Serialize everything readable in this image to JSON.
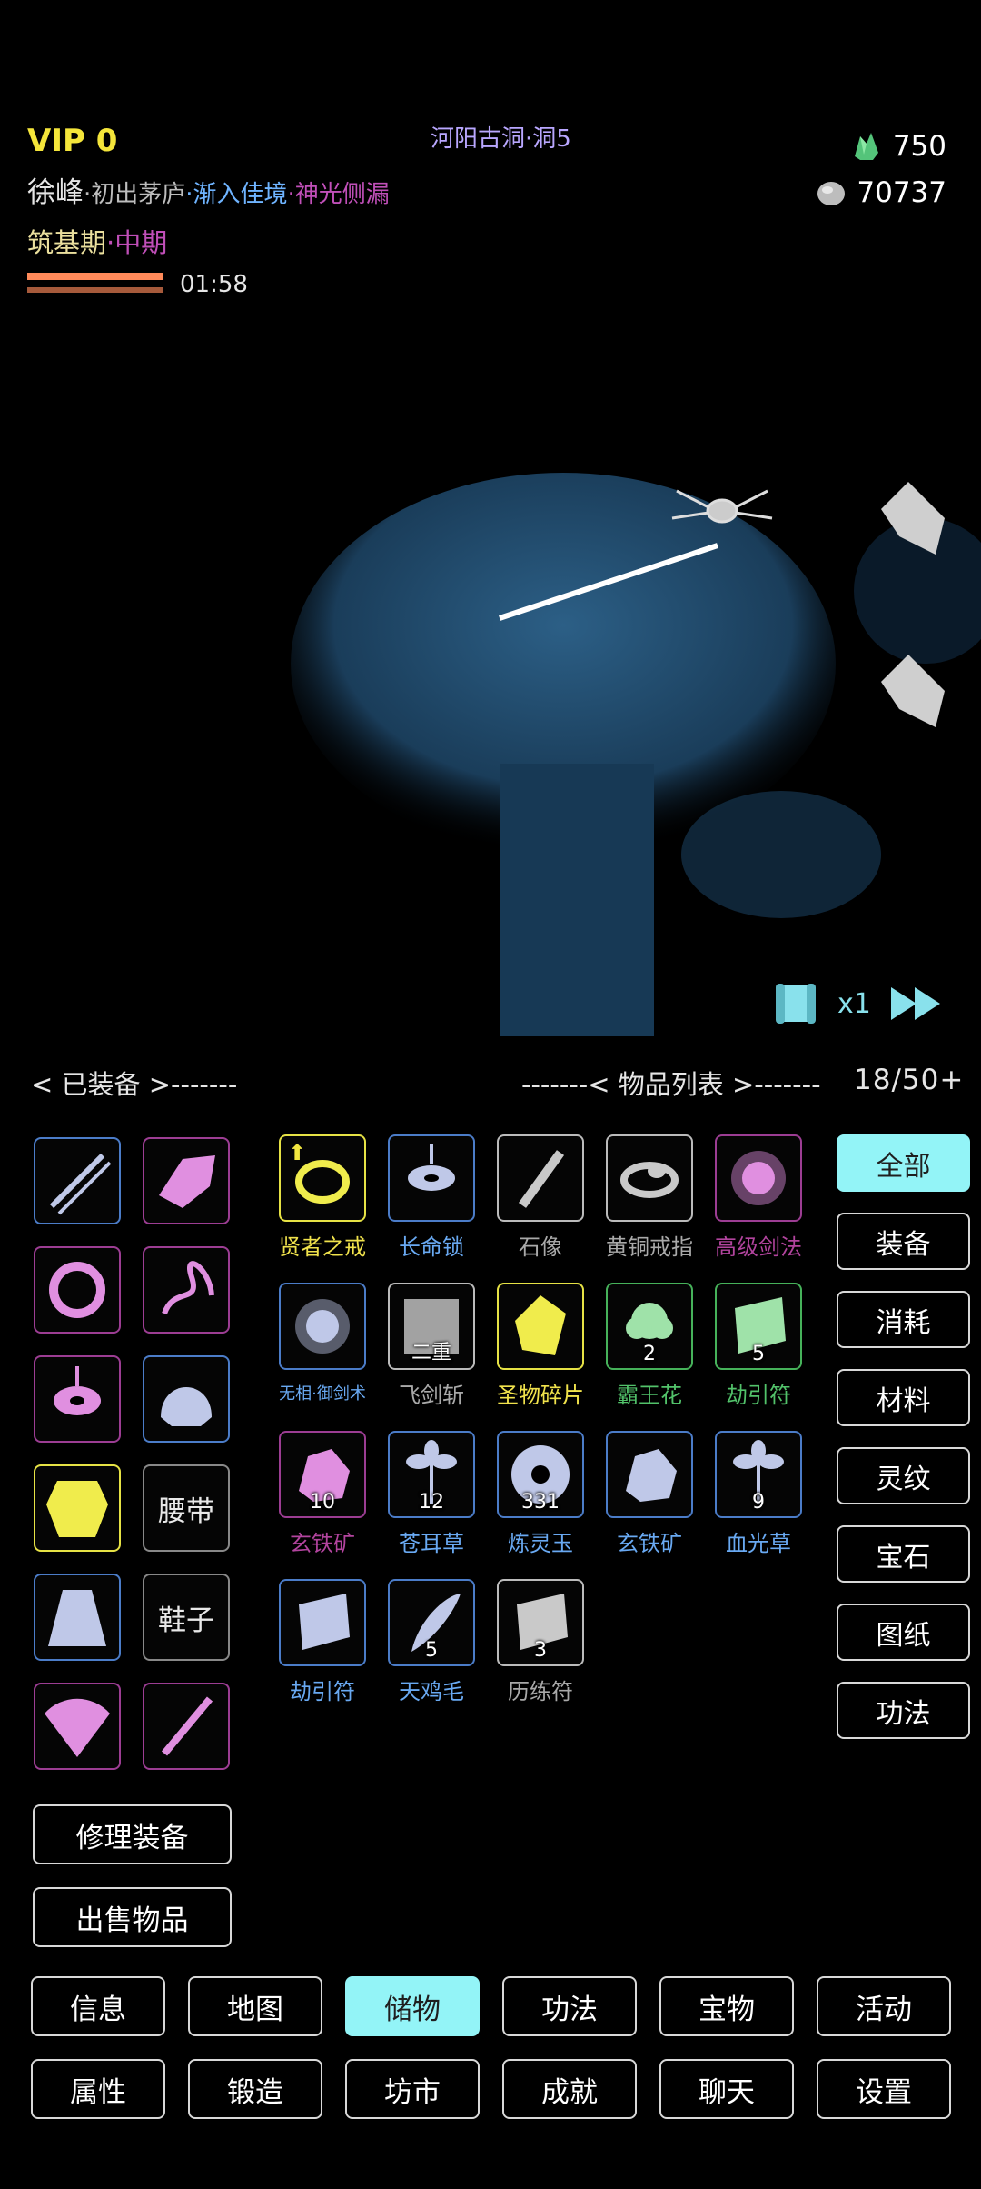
{
  "hud": {
    "vip": "VIP 0",
    "name": "徐峰",
    "status1": "·初出茅庐",
    "status2": "·渐入佳境",
    "status3": "·神光侧漏",
    "realm": "筑基期",
    "realm_stage": "·中期",
    "timer": "01:58",
    "location": "河阳古洞·洞5",
    "jade_amount": "750",
    "silver_amount": "70737"
  },
  "battle": {
    "speed": "x1"
  },
  "equipped": {
    "header": "< 已装备 >-------",
    "slots": [
      {
        "icon": "sword-icon",
        "rarity": "blue"
      },
      {
        "icon": "gauntlet-icon",
        "rarity": "purple"
      },
      {
        "icon": "ring-icon",
        "rarity": "purple"
      },
      {
        "icon": "aura-icon",
        "rarity": "purple"
      },
      {
        "icon": "pendant-icon",
        "rarity": "purple"
      },
      {
        "icon": "helmet-icon",
        "rarity": "blue"
      },
      {
        "icon": "armor-icon",
        "rarity": "yellow"
      },
      {
        "label": "腰带",
        "rarity": "gray"
      },
      {
        "icon": "skirt-icon",
        "rarity": "blue"
      },
      {
        "label": "鞋子",
        "rarity": "gray"
      },
      {
        "icon": "fan-icon",
        "rarity": "purple"
      },
      {
        "icon": "flute-icon",
        "rarity": "purple"
      }
    ]
  },
  "inventory": {
    "header": "-------< 物品列表 >-------",
    "capacity": "18/50+",
    "items": [
      {
        "name": "贤者之戒",
        "color": "yellow",
        "icon": "gold-ring-icon",
        "upgrade": true
      },
      {
        "name": "长命锁",
        "color": "blue",
        "icon": "lock-pendant-icon"
      },
      {
        "name": "石像",
        "color": "gray",
        "icon": "stone-statue-icon"
      },
      {
        "name": "黄铜戒指",
        "color": "gray",
        "icon": "brass-ring-icon"
      },
      {
        "name": "高级剑法",
        "color": "purple",
        "icon": "sword-art-orb-icon"
      },
      {
        "name": "无相·御剑术",
        "color": "blue",
        "icon": "sword-art-orb-icon",
        "small": true
      },
      {
        "name": "飞剑斩",
        "color": "gray",
        "icon": "scroll-icon",
        "count": "二重"
      },
      {
        "name": "圣物碎片",
        "color": "yellow",
        "icon": "relic-shard-icon"
      },
      {
        "name": "霸王花",
        "color": "green",
        "icon": "flower-icon",
        "count": "2"
      },
      {
        "name": "劫引符",
        "color": "green",
        "icon": "talisman-icon",
        "count": "5"
      },
      {
        "name": "玄铁矿",
        "color": "purple",
        "icon": "ore-icon",
        "count": "10"
      },
      {
        "name": "苍耳草",
        "color": "blue",
        "icon": "herb-icon",
        "count": "12"
      },
      {
        "name": "炼灵玉",
        "color": "blue",
        "icon": "jade-disc-icon",
        "count": "331"
      },
      {
        "name": "玄铁矿",
        "color": "blue",
        "icon": "ore-icon"
      },
      {
        "name": "血光草",
        "color": "blue",
        "icon": "herb-icon",
        "count": "9"
      },
      {
        "name": "劫引符",
        "color": "blue",
        "icon": "talisman-icon"
      },
      {
        "name": "天鸡毛",
        "color": "blue",
        "icon": "feather-icon",
        "count": "5"
      },
      {
        "name": "历练符",
        "color": "gray",
        "icon": "talisman-icon",
        "count": "3"
      }
    ]
  },
  "filters": [
    "全部",
    "装备",
    "消耗",
    "材料",
    "灵纹",
    "宝石",
    "图纸",
    "功法"
  ],
  "actions": {
    "repair": "修理装备",
    "sell": "出售物品"
  },
  "nav_row1": [
    "信息",
    "地图",
    "储物",
    "功法",
    "宝物",
    "活动"
  ],
  "nav_row2": [
    "属性",
    "锻造",
    "坊市",
    "成就",
    "聊天",
    "设置"
  ],
  "colors": {
    "accent": "#93f4f7",
    "vip": "#f4e53a",
    "rarity_blue": "#4b7cc8",
    "rarity_purple": "#9c3d93",
    "rarity_yellow": "#e6e245",
    "rarity_green": "#46b25a"
  }
}
